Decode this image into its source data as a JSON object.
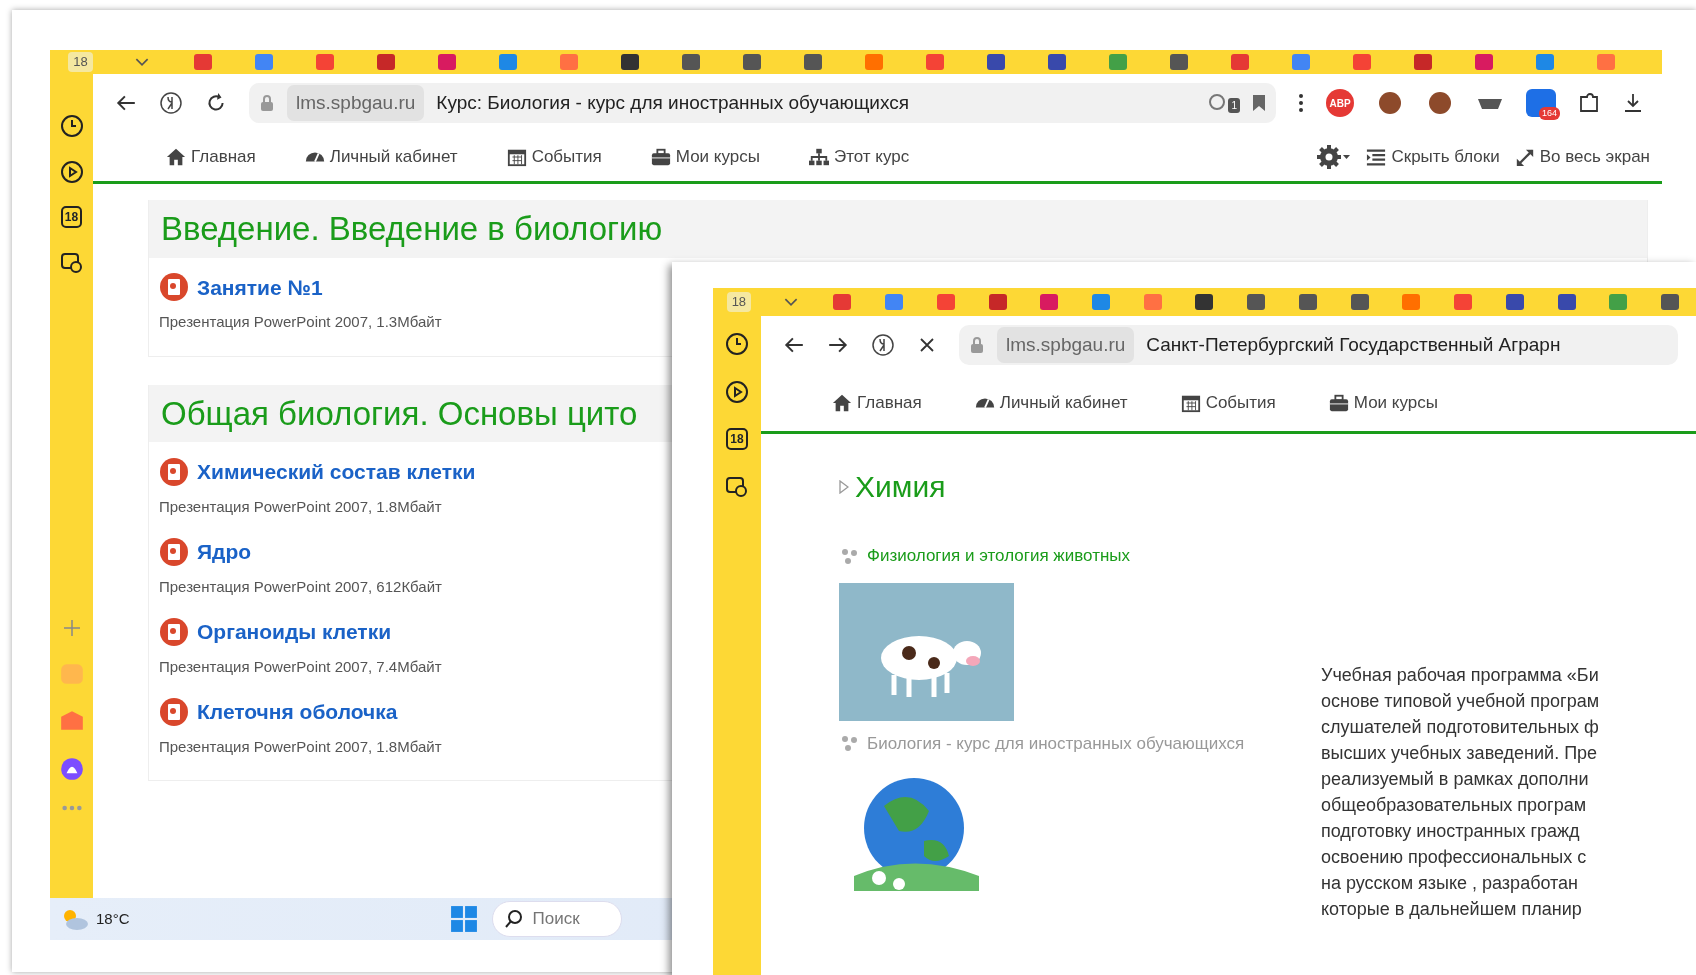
{
  "main_window": {
    "tab_strip": {
      "counter": "18"
    },
    "address_bar": {
      "url": "lms.spbgau.ru",
      "page_title": "Курс: Биология - курс для иностранных обучающихся",
      "translate_badge": "1",
      "adblock_label": "ABP",
      "extension_badge": "164"
    },
    "sidebar": {
      "calendar_day": "18"
    },
    "nav": {
      "items": [
        {
          "label": "Главная",
          "kind": "home"
        },
        {
          "label": "Личный кабинет",
          "kind": "dashboard"
        },
        {
          "label": "События",
          "kind": "calendar"
        },
        {
          "label": "Мои курсы",
          "kind": "briefcase"
        },
        {
          "label": "Этот курс",
          "kind": "sitemap"
        }
      ],
      "actions": [
        {
          "label": "Скрыть блоки",
          "kind": "hide"
        },
        {
          "label": "Во весь экран",
          "kind": "expand"
        }
      ]
    },
    "sections": [
      {
        "title": "Введение. Введение в биологию",
        "resources": [
          {
            "title": "Занятие №1",
            "details": "Презентация PowerPoint 2007, 1.3Мбайт"
          }
        ]
      },
      {
        "title": "Общая биология. Основы цито",
        "resources": [
          {
            "title": "Химический состав клетки",
            "details": "Презентация PowerPoint 2007, 1.8Мбайт"
          },
          {
            "title": "Ядро",
            "details": "Презентация PowerPoint 2007, 612Кбайт"
          },
          {
            "title": "Органоиды клетки",
            "details": "Презентация PowerPoint 2007, 7.4Мбайт"
          },
          {
            "title": "Клеточня оболочка",
            "details": "Презентация PowerPoint 2007, 1.8Мбайт"
          }
        ]
      }
    ]
  },
  "taskbar": {
    "temperature": "18°C",
    "search_placeholder": "Поиск"
  },
  "overlay_window": {
    "tab_strip": {
      "counter": "18"
    },
    "address_bar": {
      "url": "lms.spbgau.ru",
      "page_title": "Санкт-Петербургский Государственный Аграрн"
    },
    "sidebar": {
      "calendar_day": "18"
    },
    "nav": {
      "items": [
        {
          "label": "Главная",
          "kind": "home"
        },
        {
          "label": "Личный кабинет",
          "kind": "dashboard"
        },
        {
          "label": "События",
          "kind": "calendar"
        },
        {
          "label": "Мои курсы",
          "kind": "briefcase"
        }
      ]
    },
    "section_title": "Химия",
    "courses": [
      {
        "title": "Физиология и этология животных",
        "kind": "cow",
        "hidden": false
      },
      {
        "title": "Биология - курс для иностранных обучающихся",
        "kind": "globe",
        "hidden": true
      }
    ],
    "description_lines": [
      "Учебная рабочая программа «Би",
      "основе типовой учебной програм",
      "слушателей подготовительных ф",
      "высших учебных заведений. Пре",
      "реализуемый в рамках дополни",
      "общеобразовательных програм",
      "подготовку иностранных гражд",
      "освоению профессиональных с",
      "на русском языке , разработан",
      "которые в дальнейшем планир"
    ]
  }
}
